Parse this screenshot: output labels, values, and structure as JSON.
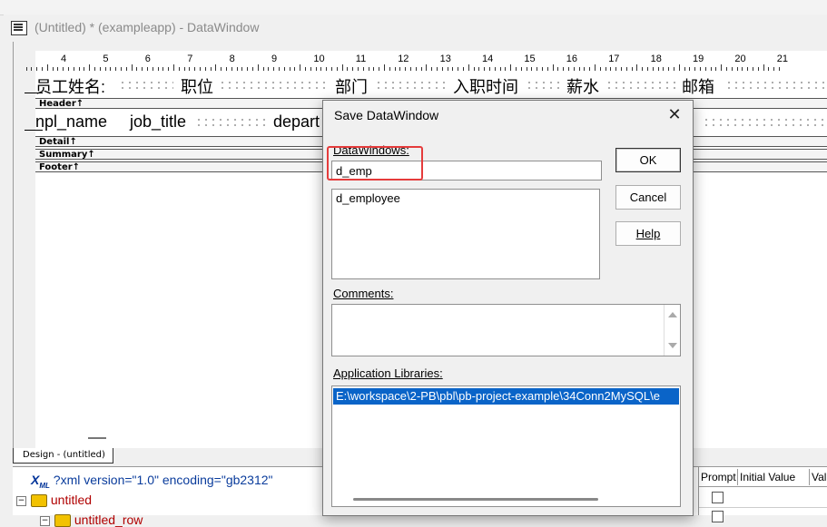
{
  "window": {
    "title": "(Untitled) * (exampleapp) - DataWindow"
  },
  "ruler": {
    "numbers": [
      "4",
      "5",
      "6",
      "7",
      "8",
      "9",
      "10",
      "11",
      "12",
      "13",
      "14",
      "15",
      "16",
      "17",
      "18",
      "19",
      "20",
      "21"
    ]
  },
  "design": {
    "header_labels": [
      "员工姓名:",
      "职位",
      "部门",
      "入职时间",
      "薪水",
      "邮箱"
    ],
    "detail_fields": [
      "npl_name",
      "job_title",
      "depart"
    ],
    "bands": {
      "header": "Header↑",
      "detail": "Detail↑",
      "summary": "Summary↑",
      "footer": "Footer↑"
    }
  },
  "tab": {
    "label": "Design - (untitled)"
  },
  "tree": {
    "xml_icon": "X",
    "xml_icon_sub": "ML",
    "xml_decl": "?xml version=\"1.0\" encoding=\"gb2312\"",
    "root": "untitled",
    "child": "untitled_row",
    "columns": [
      "Prompt",
      "Initial Value",
      "Valid"
    ]
  },
  "dialog": {
    "title": "Save DataWindow",
    "close_glyph": "✕",
    "datawindows_label": "DataWindows:",
    "name_value": "d_emp",
    "datawindows_list": [
      "d_employee"
    ],
    "comments_label": "Comments:",
    "comments_value": "",
    "libraries_label": "Application Libraries:",
    "libraries": [
      "E:\\workspace\\2-PB\\pbl\\pb-project-example\\34Conn2MySQL\\e"
    ],
    "ok_label": "OK",
    "cancel_label": "Cancel",
    "help_label": "Help",
    "highlight_color": "#e53b3b",
    "selection_color": "#0a64c8"
  }
}
